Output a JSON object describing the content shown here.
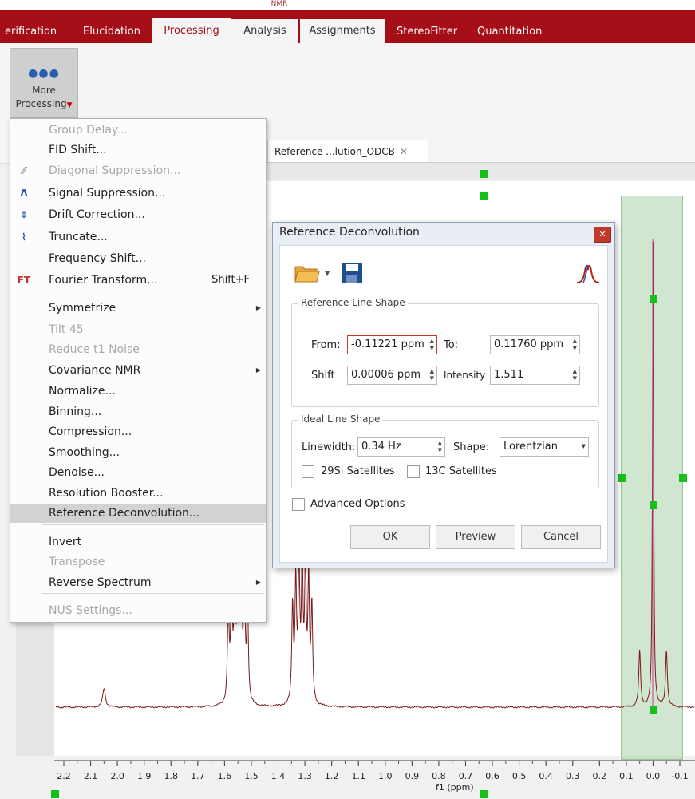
{
  "ribbon": {
    "context_label": "NMR",
    "tabs": [
      "erification",
      "Elucidation",
      "Processing",
      "Analysis",
      "Assignments",
      "StereoFitter",
      "Quantitation"
    ],
    "more_processing_line1": "More",
    "more_processing_line2": "Processing"
  },
  "document_tab": {
    "title": "Reference ...lution_ODCB",
    "close": "✕"
  },
  "menu": {
    "items": [
      {
        "label": "Group Delay...",
        "disabled": true
      },
      {
        "label": "FID Shift...",
        "disabled": false
      },
      {
        "label": "Diagonal Suppression...",
        "disabled": true,
        "icon": "diagonal-suppression-icon"
      },
      {
        "label": "Signal Suppression...",
        "disabled": false,
        "icon": "signal-suppression-icon"
      },
      {
        "label": "Drift Correction...",
        "disabled": false,
        "icon": "drift-correction-icon"
      },
      {
        "label": "Truncate...",
        "disabled": false,
        "icon": "truncate-icon"
      },
      {
        "label": "Frequency Shift...",
        "disabled": false
      },
      {
        "label": "Fourier Transform...",
        "disabled": false,
        "icon": "fourier-transform-icon",
        "shortcut": "Shift+F"
      },
      {
        "label": "Symmetrize",
        "disabled": false,
        "submenu": true
      },
      {
        "label": "Tilt 45",
        "disabled": true
      },
      {
        "label": "Reduce t1 Noise",
        "disabled": true
      },
      {
        "label": "Covariance NMR",
        "disabled": false,
        "submenu": true
      },
      {
        "label": "Normalize...",
        "disabled": false
      },
      {
        "label": "Binning...",
        "disabled": false
      },
      {
        "label": "Compression...",
        "disabled": false
      },
      {
        "label": "Smoothing...",
        "disabled": false
      },
      {
        "label": "Denoise...",
        "disabled": false
      },
      {
        "label": "Resolution Booster...",
        "disabled": false
      },
      {
        "label": "Reference Deconvolution...",
        "disabled": false,
        "highlighted": true
      },
      {
        "label": "Invert",
        "disabled": false
      },
      {
        "label": "Transpose",
        "disabled": true
      },
      {
        "label": "Reverse Spectrum",
        "disabled": false,
        "submenu": true
      },
      {
        "label": "NUS Settings...",
        "disabled": true
      }
    ]
  },
  "dialog": {
    "title": "Reference Deconvolution",
    "reference_group": "Reference Line Shape",
    "from_label": "From:",
    "from_value": "-0.11221 ppm",
    "to_label": "To:",
    "to_value": "0.11760 ppm",
    "shift_label": "Shift",
    "shift_value": "0.00006 ppm",
    "intensity_label": "Intensity",
    "intensity_value": "1.511",
    "ideal_group": "Ideal Line Shape",
    "linewidth_label": "Linewidth:",
    "linewidth_value": "0.34 Hz",
    "shape_label": "Shape:",
    "shape_value": "Lorentzian",
    "si_satellites": "29Si Satellites",
    "c_satellites": "13C Satellites",
    "advanced_options": "Advanced Options",
    "ok": "OK",
    "preview": "Preview",
    "cancel": "Cancel"
  },
  "chart_data": {
    "type": "line",
    "xlabel": "f1 (ppm)",
    "xlim": [
      2.25,
      -0.13
    ],
    "x_ticks": [
      "2.2",
      "2.1",
      "2.0",
      "1.9",
      "1.8",
      "1.7",
      "1.6",
      "1.5",
      "1.4",
      "1.3",
      "1.2",
      "1.1",
      "1.0",
      "0.9",
      "0.8",
      "0.7",
      "0.6",
      "0.5",
      "0.4",
      "0.3",
      "0.2",
      "0.1",
      "0.0",
      "-0.1"
    ],
    "peaks": [
      {
        "ppm": 2.05,
        "height": 0.04
      },
      {
        "ppm": 1.55,
        "height": 0.3
      },
      {
        "ppm": 1.31,
        "height": 0.3
      },
      {
        "ppm": 0.05,
        "height": 0.12
      },
      {
        "ppm": 0.0,
        "height": 1.0
      },
      {
        "ppm": -0.05,
        "height": 0.12
      }
    ],
    "selected_region_ppm": [
      0.1176,
      -0.11221
    ]
  }
}
